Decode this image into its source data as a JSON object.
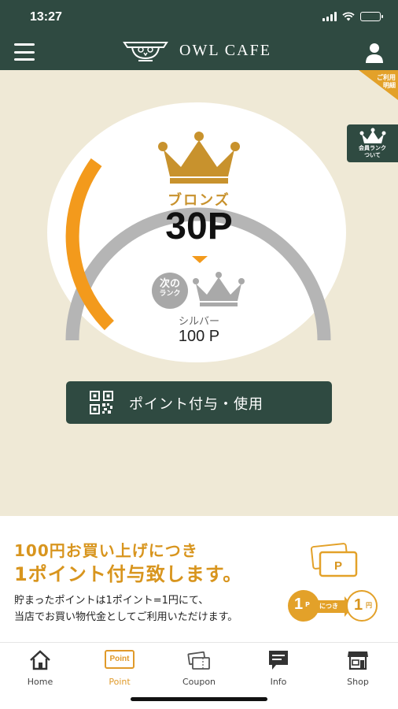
{
  "status_bar": {
    "time": "13:27",
    "icons": [
      "signal-icon",
      "wifi-icon",
      "battery-icon"
    ]
  },
  "header": {
    "brand": "OWL CAFE",
    "menu_icon": "hamburger-icon",
    "user_icon": "user-icon"
  },
  "history_tab": {
    "line1": "ご利用",
    "line2": "明細"
  },
  "rank_about": {
    "line1": "会員ランク",
    "line2": "ついて"
  },
  "rank_card": {
    "current_rank": "ブロンズ",
    "points": "30P",
    "next_badge_line1": "次の",
    "next_badge_line2": "ランク",
    "next_rank": "シルバー",
    "next_rank_points": "100 P",
    "progress_fraction": 0.3
  },
  "action": {
    "label": "ポイント付与・使用",
    "icon": "qr-code-icon"
  },
  "info": {
    "line1": "100円お買い上げにつき",
    "line2": "1ポイント付与致します。",
    "desc1": "貯まったポイントは1ポイント=1円にて、",
    "desc2": "当店でお買い物代金としてご利用いただけます。",
    "card_label": "P",
    "rate_left_num": "1",
    "rate_left_unit": "P",
    "rate_mid": "につき",
    "rate_right_num": "1",
    "rate_right_unit": "円"
  },
  "tabs": [
    {
      "label": "Home",
      "icon": "home-icon",
      "active": false
    },
    {
      "label": "Point",
      "icon_text": "Point",
      "active": true
    },
    {
      "label": "Coupon",
      "icon": "coupon-icon",
      "active": false
    },
    {
      "label": "Info",
      "icon": "info-icon",
      "active": false
    },
    {
      "label": "Shop",
      "icon": "shop-icon",
      "active": false
    }
  ],
  "colors": {
    "header_bg": "#2f4a41",
    "page_bg": "#efe9d6",
    "accent_orange": "#f39a1c",
    "gold": "#c8922d",
    "gray_track": "#b5b5b5"
  }
}
